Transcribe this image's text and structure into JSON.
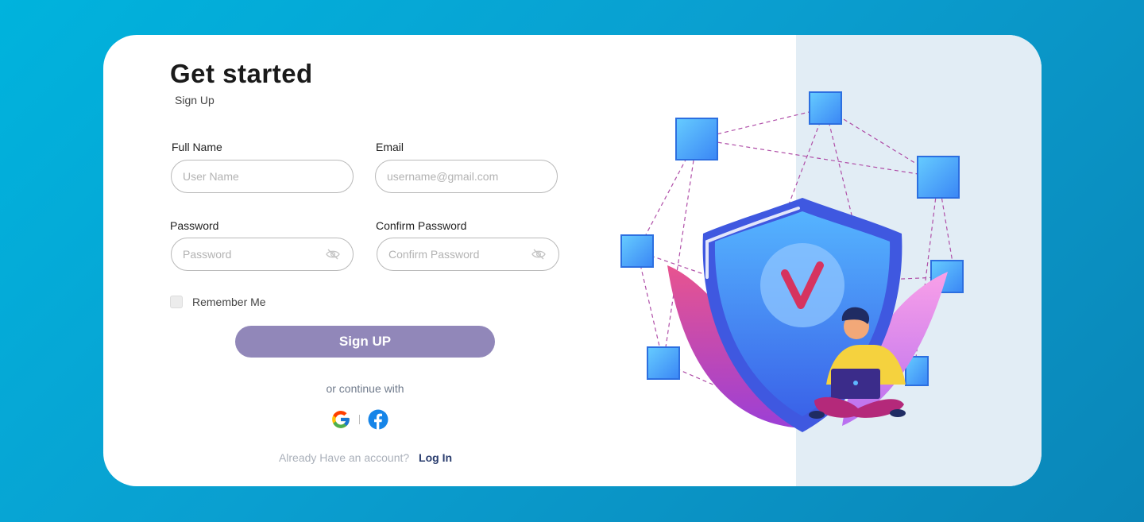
{
  "heading": {
    "title": "Get started",
    "subtitle": "Sign Up"
  },
  "form": {
    "full_name": {
      "label": "Full Name",
      "placeholder": "User Name"
    },
    "email": {
      "label": "Email",
      "placeholder": "username@gmail.com"
    },
    "password": {
      "label": "Password",
      "placeholder": "Password"
    },
    "confirm_password": {
      "label": "Confirm Password",
      "placeholder": "Confirm Password"
    },
    "remember_me": {
      "label": "Remember Me",
      "checked": false
    },
    "submit_label": "Sign UP"
  },
  "social": {
    "divider_text": "or continue with",
    "providers": [
      {
        "name": "Google",
        "icon": "google-icon"
      },
      {
        "name": "Facebook",
        "icon": "facebook-icon"
      }
    ]
  },
  "footer": {
    "question": "Already Have an account?",
    "login_label": "Log In"
  },
  "colors": {
    "background": "#00b3dd",
    "button": "#9187b9",
    "right_panel": "#e2edf5",
    "shield": "#3d7ef0",
    "check": "#d6335f"
  }
}
